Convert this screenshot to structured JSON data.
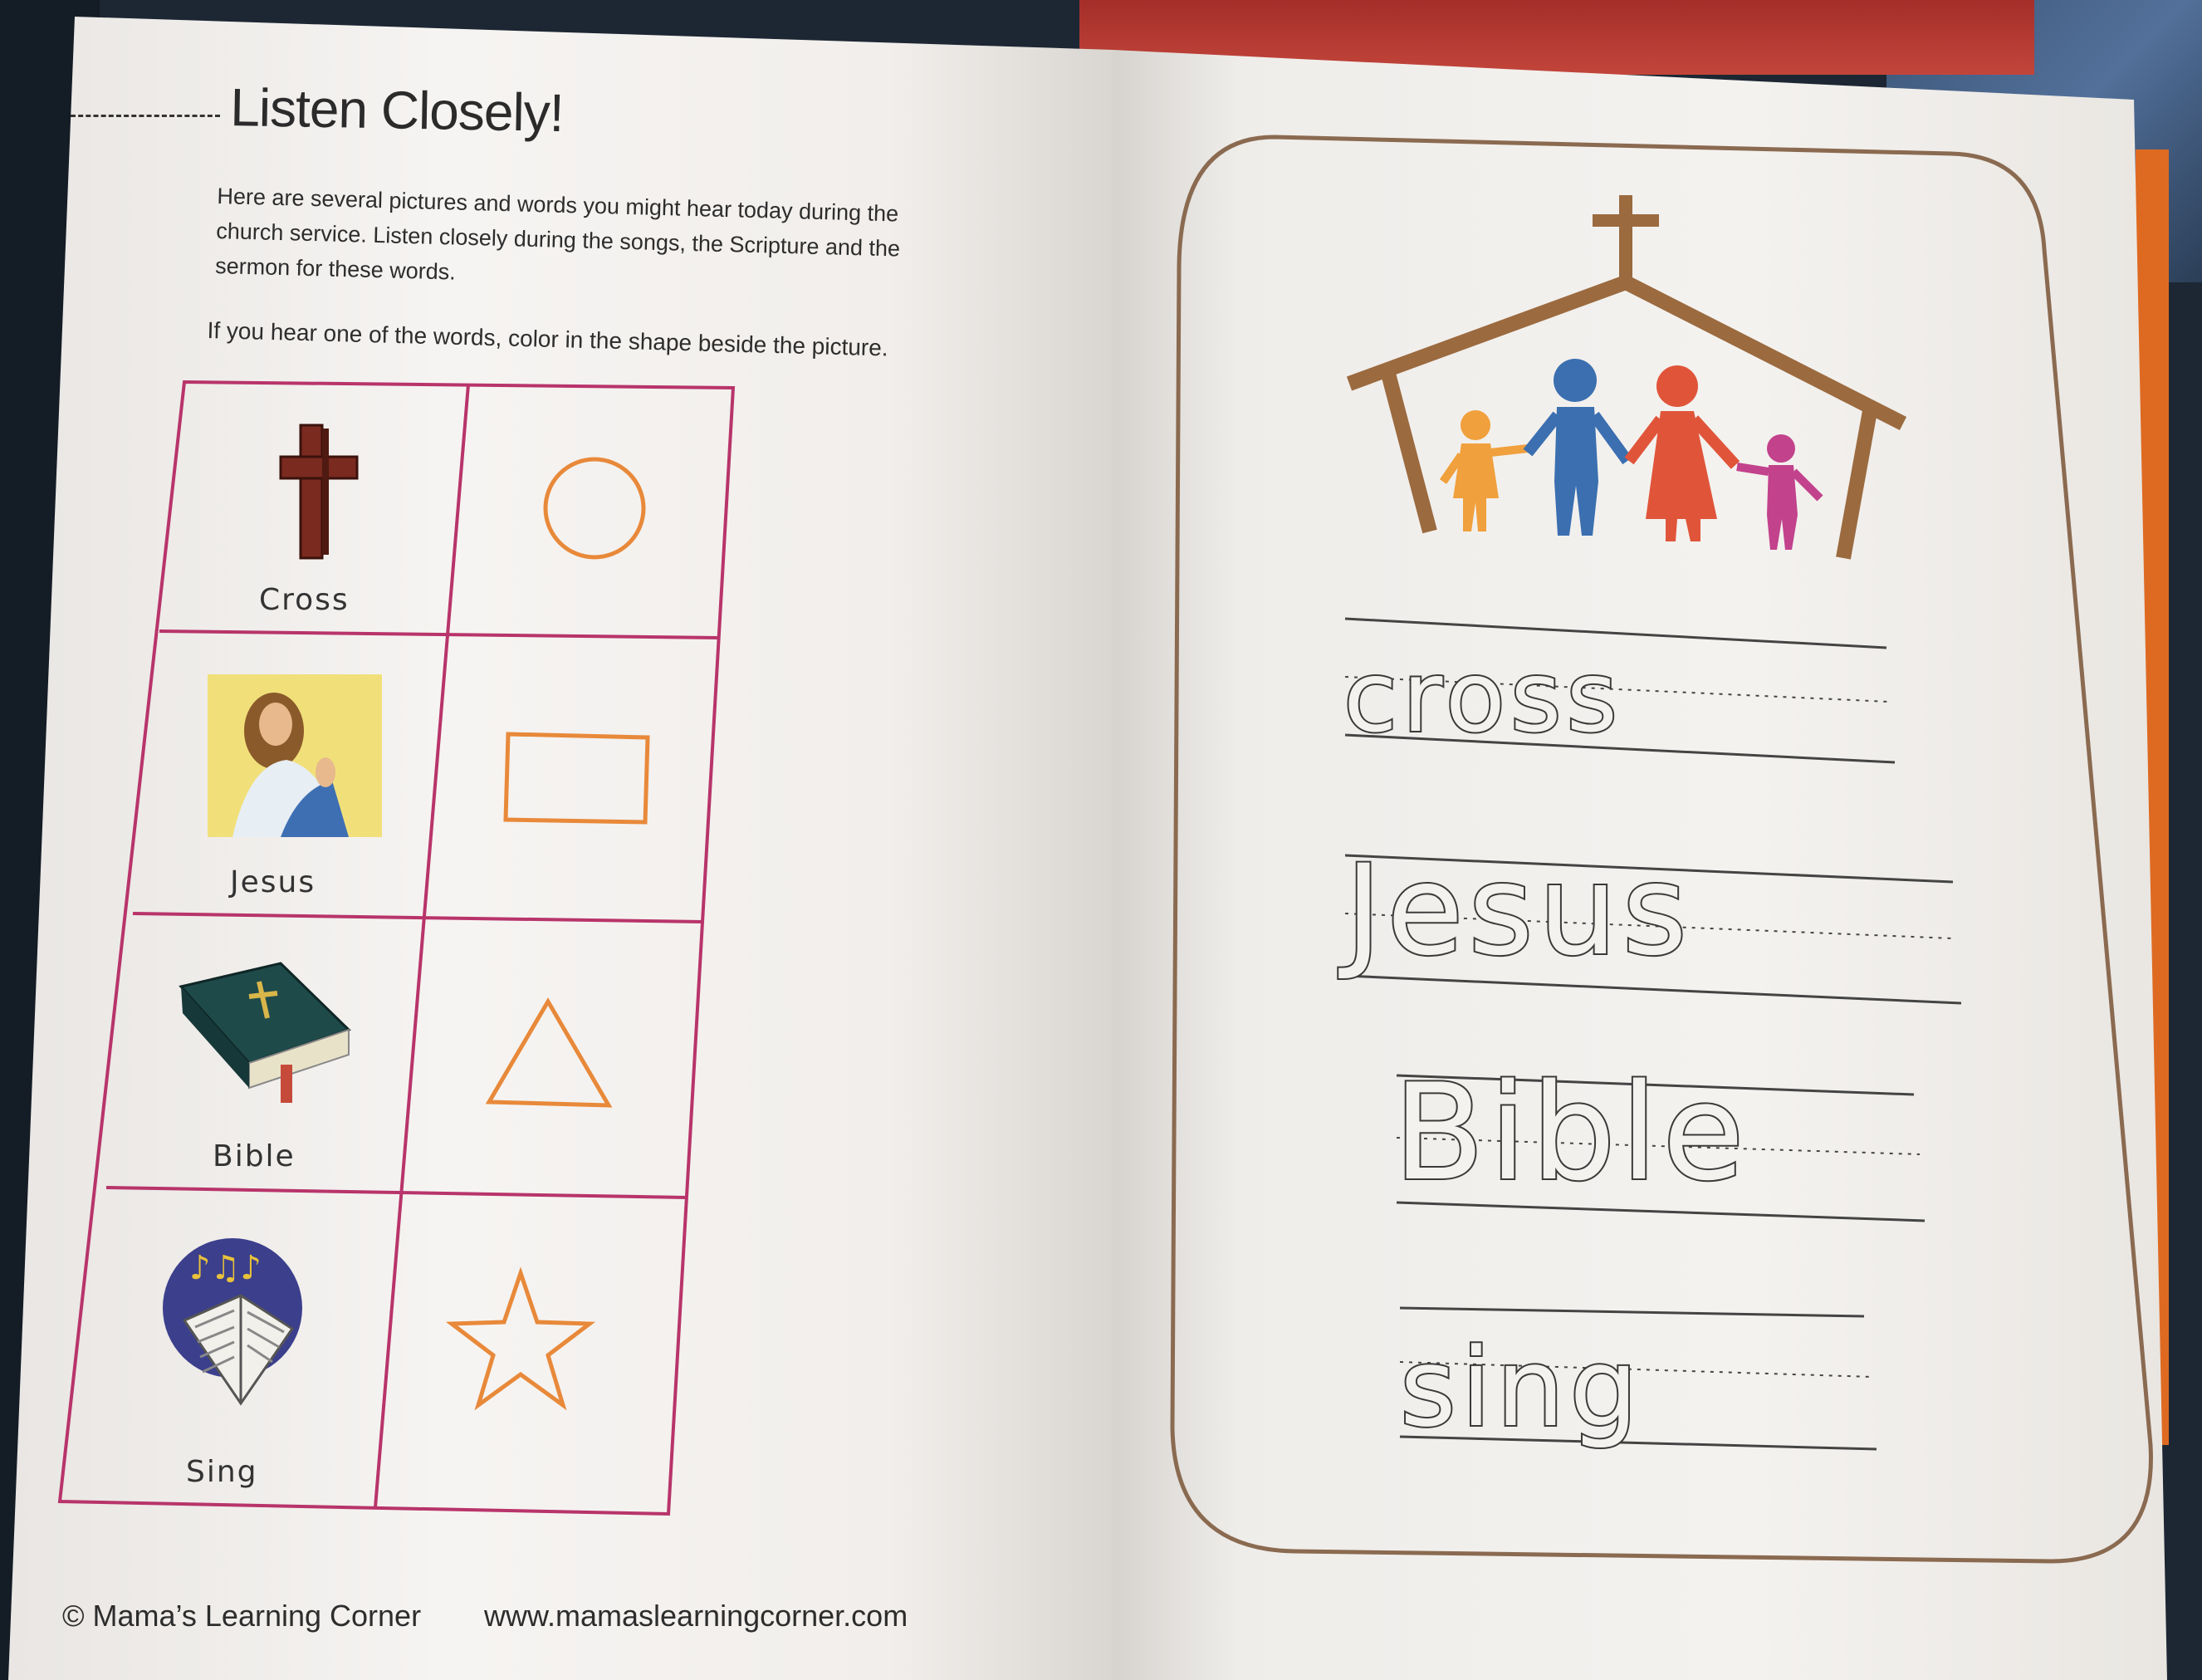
{
  "worksheet": {
    "title": "Listen Closely!",
    "intro_lines": [
      "Here are several pictures and words you might hear today during the",
      "church service.  Listen closely during the songs, the Scripture and the",
      "sermon for these words."
    ],
    "instruction": "If you hear one of the words, color in the shape beside the picture.",
    "rows": [
      {
        "label": "Cross",
        "picture": "cross-icon",
        "shape": "circle"
      },
      {
        "label": "Jesus",
        "picture": "jesus-portrait",
        "shape": "rectangle"
      },
      {
        "label": "Bible",
        "picture": "bible-icon",
        "shape": "triangle"
      },
      {
        "label": "Sing",
        "picture": "songbook-icon",
        "shape": "star"
      }
    ],
    "footer_copyright": "© Mama’s Learning Corner",
    "footer_url": "www.mamaslearningcorner.com"
  },
  "tracing_card": {
    "illustration": "church-family-icon",
    "words": [
      "cross",
      "Jesus",
      "Bible",
      "sing"
    ]
  },
  "colors": {
    "grid_border": "#b8346a",
    "shape_outline": "#e8893a",
    "cross_brown": "#7a2a1f",
    "card_border": "#8a6a50",
    "church_brown": "#9b6a3f",
    "figure_orange": "#f0a03c",
    "figure_blue": "#3b6fb0",
    "figure_red": "#e0553a",
    "figure_pink": "#c2428c"
  }
}
